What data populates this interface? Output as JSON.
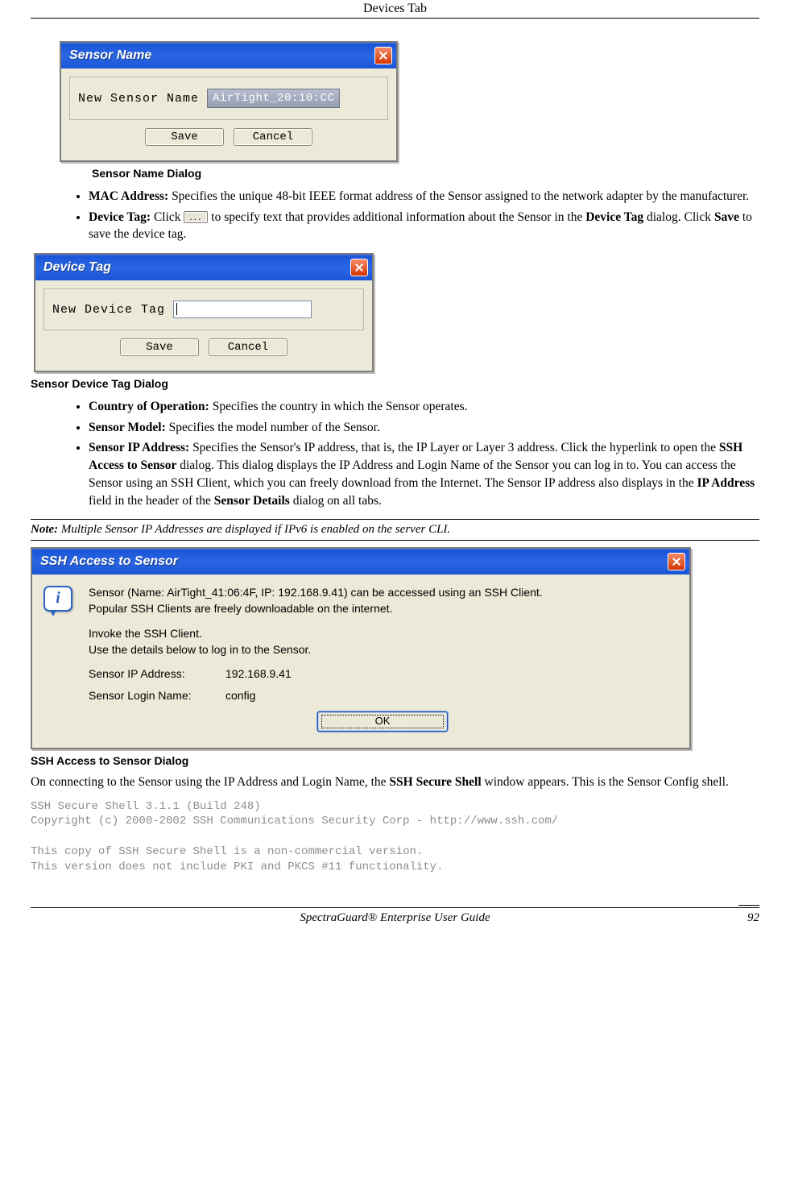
{
  "header": {
    "title": "Devices Tab"
  },
  "sensor_name_dialog": {
    "title": "Sensor Name",
    "label": "New  Sensor Name",
    "value": "AirTight_20:10:CC",
    "save": "Save",
    "cancel": "Cancel",
    "caption": "Sensor Name Dialog"
  },
  "bullets1": {
    "mac_label": "MAC Address:",
    "mac_text": " Specifies the unique 48-bit IEEE format address of the Sensor assigned to the network adapter by the manufacturer.",
    "dt_label": "Device Tag:",
    "dt_text_a": " Click ",
    "dt_text_b": " to specify text that provides additional information about the Sensor in the ",
    "dt_bold2": "Device Tag",
    "dt_text_c": " dialog. Click ",
    "dt_bold3": "Save",
    "dt_text_d": " to save the device tag."
  },
  "device_tag_dialog": {
    "title": "Device Tag",
    "label": "New  Device Tag",
    "save": "Save",
    "cancel": "Cancel",
    "caption": "Sensor Device Tag Dialog"
  },
  "bullets2": {
    "coo_label": "Country of Operation:",
    "coo_text": " Specifies the country in which the Sensor operates.",
    "sm_label": "Sensor Model:",
    "sm_text": " Specifies the model number of the Sensor.",
    "sip_label": "Sensor IP Address:",
    "sip_a": " Specifies the Sensor's IP address, that is, the IP Layer or Layer 3 address. Click the hyperlink to open the ",
    "sip_b1": "SSH Access to Sensor",
    "sip_b": " dialog. This dialog displays the IP Address and Login Name of the Sensor you can log in to. You can access the Sensor using an SSH Client, which you can freely download from the Internet. The Sensor IP address also displays in the ",
    "sip_b2": "IP Address",
    "sip_c": " field in the header of the ",
    "sip_b3": "Sensor Details",
    "sip_d": " dialog on all tabs."
  },
  "note": {
    "label": "Note:",
    "text": " Multiple Sensor IP Addresses are displayed if IPv6 is enabled on the server CLI."
  },
  "ssh_dialog": {
    "title": "SSH Access to Sensor",
    "line1": "Sensor (Name: AirTight_41:06:4F, IP: 192.168.9.41) can be accessed using an SSH Client.",
    "line2": "Popular SSH Clients are freely downloadable on the internet.",
    "line3": "Invoke the SSH Client.",
    "line4": "Use the details below to log in to the Sensor.",
    "ip_label": "Sensor IP Address:",
    "ip_value": "192.168.9.41",
    "login_label": "Sensor Login Name:",
    "login_value": "config",
    "ok": "OK",
    "caption": "SSH Access to Sensor Dialog"
  },
  "para_after_ssh": {
    "a": "On connecting to the Sensor using the IP Address and Login Name, the ",
    "b1": "SSH Secure Shell",
    "b": " window appears. This is the Sensor Config shell."
  },
  "terminal": {
    "l1": "SSH Secure Shell 3.1.1 (Build 248)",
    "l2": "Copyright (c) 2000-2002 SSH Communications Security Corp - http://www.ssh.com/",
    "l3": "This copy of SSH Secure Shell is a non-commercial version.",
    "l4": "This version does not include PKI and PKCS #11 functionality."
  },
  "footer": {
    "title": "SpectraGuard® Enterprise User Guide",
    "page": "92"
  }
}
